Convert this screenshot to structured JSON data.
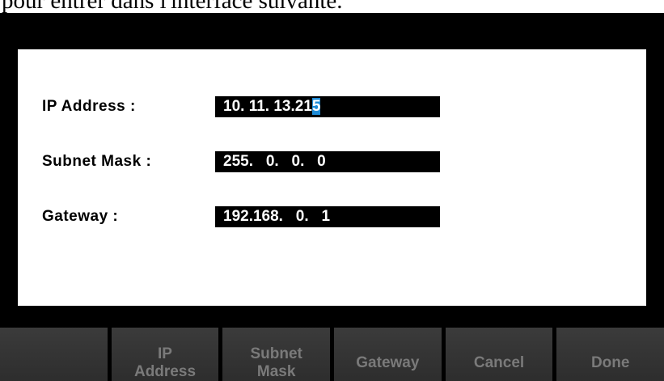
{
  "caption": "pour entrer dans l'interface suivante.",
  "fields": [
    {
      "label": "IP Address :",
      "value_main": "10. 11. 13.21",
      "value_caret": "5"
    },
    {
      "label": "Subnet Mask :",
      "value_main": "255.   0.   0.   0",
      "value_caret": ""
    },
    {
      "label": "Gateway :",
      "value_main": "192.168.   0.   1",
      "value_caret": ""
    }
  ],
  "softkeys": [
    {
      "line1": "",
      "line2": ""
    },
    {
      "line1": "IP",
      "line2": "Address"
    },
    {
      "line1": "Subnet",
      "line2": "Mask"
    },
    {
      "line1": "Gateway",
      "line2": ""
    },
    {
      "line1": "Cancel",
      "line2": ""
    },
    {
      "line1": "Done",
      "line2": ""
    }
  ],
  "colors": {
    "screen_bg": "#000000",
    "panel_bg": "#ffffff",
    "field_bg": "#000000",
    "caret_highlight": "#1e8bd6",
    "softkey_bg": "#333333",
    "softkey_text": "#7a7a7a"
  }
}
